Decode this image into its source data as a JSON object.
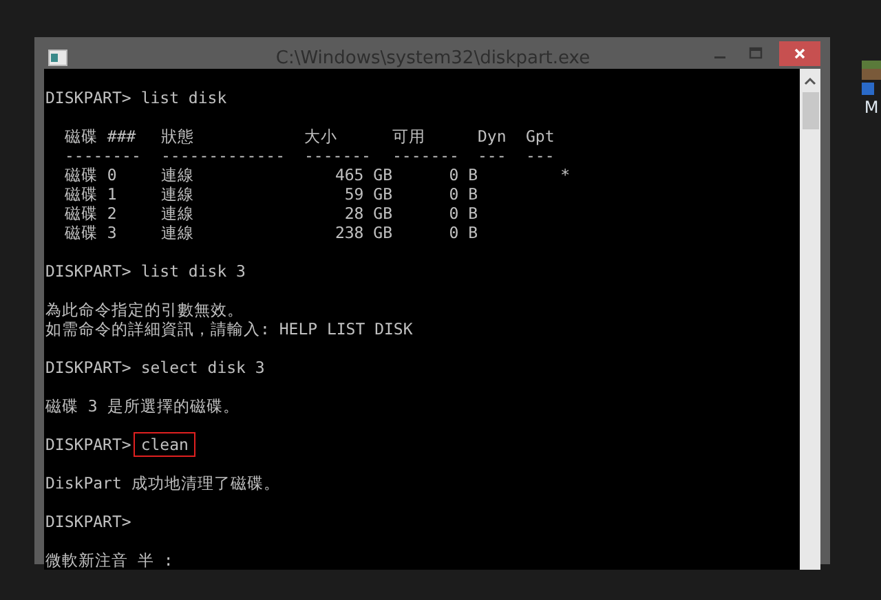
{
  "window": {
    "title": "C:\\Windows\\system32\\diskpart.exe"
  },
  "console": {
    "lines": [
      {
        "kind": "command",
        "prompt": "DISKPART>",
        "command": "list disk",
        "highlighted": false
      },
      {
        "kind": "table",
        "columns": [
          "磁碟 ###",
          "狀態",
          "大小",
          "可用",
          "Dyn",
          "Gpt"
        ],
        "separators": [
          "--------",
          "-------------",
          "-------",
          "-------",
          "---",
          "---"
        ],
        "rows": [
          [
            "磁碟 0",
            "連線",
            "465 GB",
            "0 B",
            "",
            "*"
          ],
          [
            "磁碟 1",
            "連線",
            "59 GB",
            "0 B",
            "",
            ""
          ],
          [
            "磁碟 2",
            "連線",
            "28 GB",
            "0 B",
            "",
            ""
          ],
          [
            "磁碟 3",
            "連線",
            "238 GB",
            "0 B",
            "",
            ""
          ]
        ]
      },
      {
        "kind": "command",
        "prompt": "DISKPART>",
        "command": "list disk 3",
        "highlighted": false
      },
      {
        "kind": "output",
        "texts": [
          "為此命令指定的引數無效。",
          "如需命令的詳細資訊，請輸入: HELP LIST DISK"
        ]
      },
      {
        "kind": "command",
        "prompt": "DISKPART>",
        "command": "select disk 3",
        "highlighted": false
      },
      {
        "kind": "output",
        "texts": [
          "磁碟 3 是所選擇的磁碟。"
        ]
      },
      {
        "kind": "command",
        "prompt": "DISKPART>",
        "command": "clean",
        "highlighted": true
      },
      {
        "kind": "output",
        "texts": [
          "DiskPart 成功地清理了磁碟。"
        ]
      },
      {
        "kind": "prompt",
        "prompt": "DISKPART>"
      },
      {
        "kind": "ime",
        "text": "微軟新注音 半 :"
      }
    ]
  },
  "desktop_icon": {
    "label": "M"
  }
}
